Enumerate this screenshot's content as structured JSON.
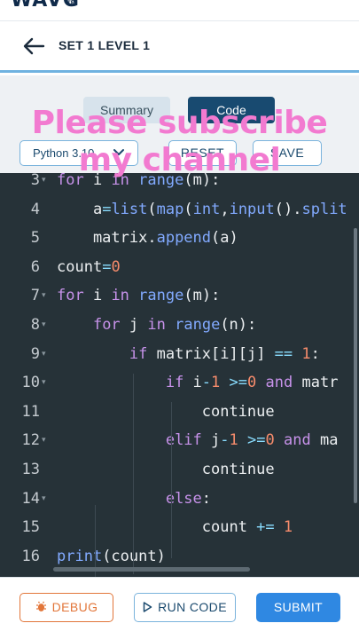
{
  "app": {
    "logo": "WAVG",
    "logo_tm": "TM"
  },
  "header": {
    "back_icon": "arrow-left-icon",
    "title": "SET 1 LEVEL 1"
  },
  "tabs": [
    {
      "label": "Summary",
      "active": false
    },
    {
      "label": "Code",
      "active": true
    }
  ],
  "toolbar": {
    "language": "Python 3.10",
    "language_icon": "chevron-down-icon",
    "reset_label": "RESET",
    "save_label": "SAVE"
  },
  "overlay": {
    "line1": "Please subscribe",
    "line2": "my channel"
  },
  "editor": {
    "lines": [
      {
        "num": "3",
        "text": "for i in range(m):",
        "fold": true
      },
      {
        "num": "4",
        "text": "    a=list(map(int,input().split",
        "fold": false
      },
      {
        "num": "5",
        "text": "    matrix.append(a)",
        "fold": false
      },
      {
        "num": "6",
        "text": "count=0",
        "fold": false
      },
      {
        "num": "7",
        "text": "for i in range(m):",
        "fold": true
      },
      {
        "num": "8",
        "text": "    for j in range(n):",
        "fold": true
      },
      {
        "num": "9",
        "text": "        if matrix[i][j] == 1:",
        "fold": true
      },
      {
        "num": "10",
        "text": "            if i-1 >=0 and matr",
        "fold": true
      },
      {
        "num": "11",
        "text": "                continue",
        "fold": false
      },
      {
        "num": "12",
        "text": "            elif j-1 >=0 and ma",
        "fold": true
      },
      {
        "num": "13",
        "text": "                continue",
        "fold": false
      },
      {
        "num": "14",
        "text": "            else:",
        "fold": true
      },
      {
        "num": "15",
        "text": "                count += 1",
        "fold": false
      },
      {
        "num": "16",
        "text": "print(count)",
        "fold": false
      }
    ]
  },
  "footer": {
    "debug_label": "DEBUG",
    "debug_icon": "bug-icon",
    "run_label": "RUN CODE",
    "run_icon": "play-icon",
    "submit_label": "SUBMIT"
  },
  "colors": {
    "accent": "#2f88e2",
    "brand_dark": "#184a70",
    "editor_bg": "#263238",
    "keyword": "#c792ea",
    "function": "#82aaff",
    "number": "#f78c6c",
    "debug": "#e2763a",
    "overlay_text": "#f27ad0"
  }
}
